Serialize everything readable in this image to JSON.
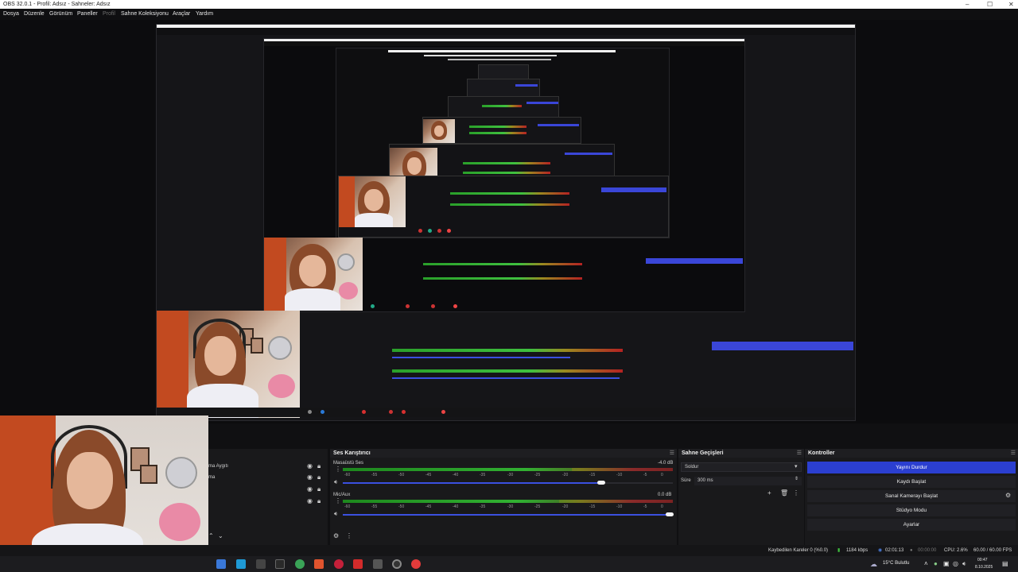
{
  "window": {
    "title": "OBS 32.0.1 - Profil: Adsız - Sahneler: Adsız",
    "controls": [
      "–",
      "☐",
      "✕"
    ]
  },
  "menu": {
    "items": [
      "Dosya",
      "Düzenle",
      "Görünüm",
      "Paneller",
      "Profil",
      "Sahne Koleksiyonu",
      "Araçlar",
      "Yardım"
    ]
  },
  "docks": {
    "sources_partial_labels": [
      "ma Aygıtı",
      "ma"
    ],
    "mixer": {
      "title": "Ses Karıştırıcı",
      "channels": [
        {
          "name": "Masaüstü Ses",
          "db": "-4.0 dB",
          "level": 0.78
        },
        {
          "name": "Mic/Aux",
          "db": "0.0 dB",
          "level": 1.0
        }
      ],
      "ticks": [
        "-60",
        "-55",
        "-50",
        "-45",
        "-40",
        "-35",
        "-30",
        "-25",
        "-20",
        "-15",
        "-10",
        "-5",
        "0"
      ]
    },
    "transitions": {
      "title": "Sahne Geçişleri",
      "selected": "Soldur",
      "duration_label": "Süre",
      "duration_value": "300 ms"
    },
    "controls": {
      "title": "Kontroller",
      "buttons": [
        "Yayını Durdur",
        "Kaydı Başlat",
        "Sanal Kamerayı Başlat",
        "Stüdyo Modu",
        "Ayarlar"
      ]
    }
  },
  "status": {
    "dropped_frames": "Kaybedilen Kareler 0 (%0.0)",
    "bitrate": "1184 kbps",
    "stream_time": "02:01:13",
    "record_time": "00:00:00",
    "cpu": "CPU: 2.6%",
    "fps": "60.00 / 60.00 FPS"
  },
  "taskbar": {
    "weather": "15°C Bulutlu",
    "time": "00:47",
    "date": "8.10.2025"
  },
  "colors": {
    "accent_blue": "#2b3fd0",
    "meter_green": "#2c9a2c",
    "meter_yellow": "#7a7a1e",
    "meter_red": "#8a2a2a",
    "bg": "#101012"
  }
}
